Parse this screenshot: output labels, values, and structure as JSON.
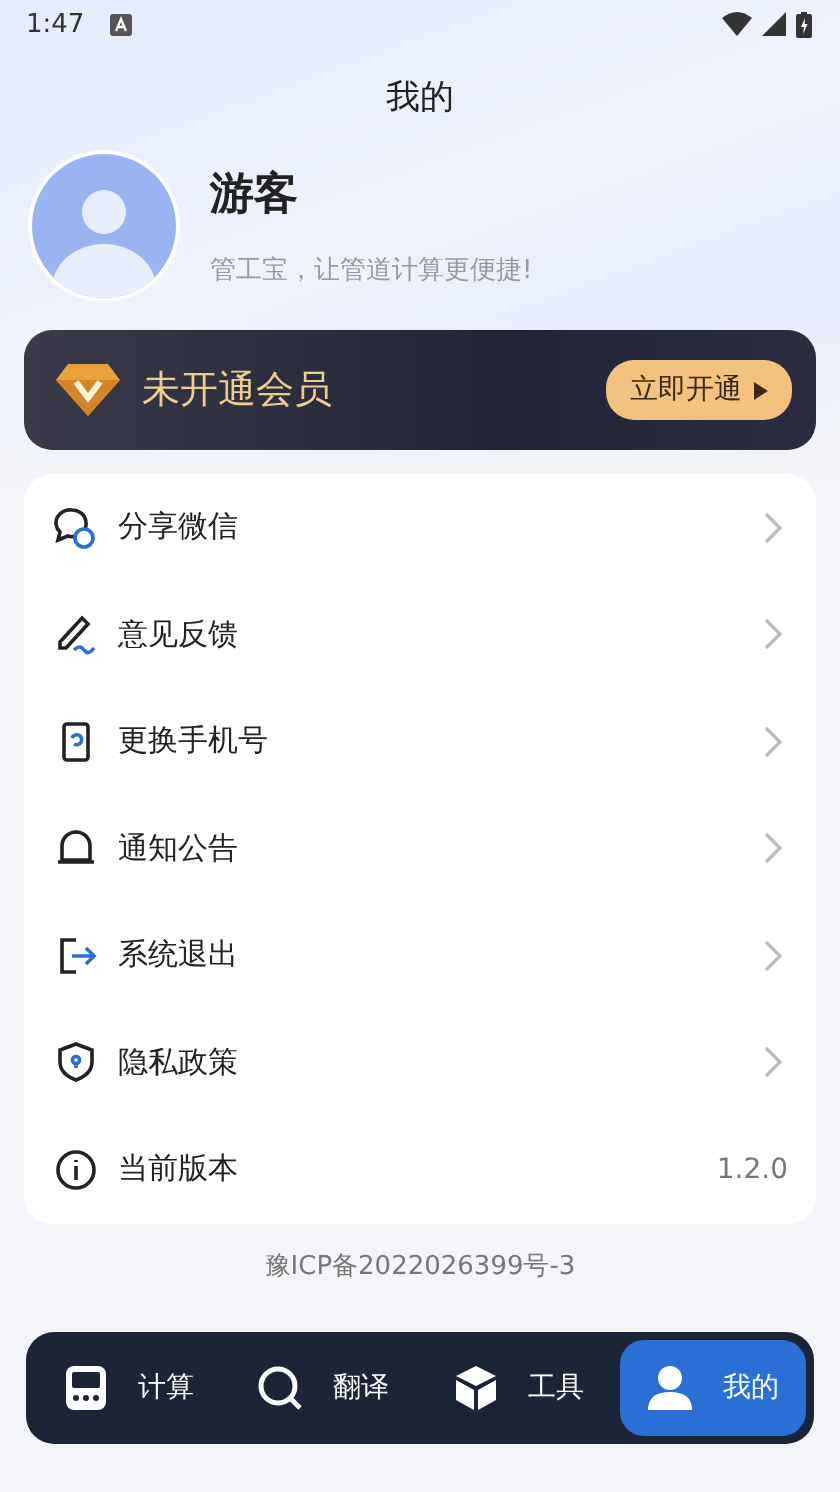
{
  "status_bar": {
    "time": "1:47"
  },
  "header": {
    "title": "我的"
  },
  "profile": {
    "name": "游客",
    "tagline": "管工宝，让管道计算更便捷!"
  },
  "membership": {
    "label": "未开通会员",
    "button": "立即开通"
  },
  "menu": [
    {
      "label": "分享微信",
      "kind": "link"
    },
    {
      "label": "意见反馈",
      "kind": "link"
    },
    {
      "label": "更换手机号",
      "kind": "link"
    },
    {
      "label": "通知公告",
      "kind": "link"
    },
    {
      "label": "系统退出",
      "kind": "link"
    },
    {
      "label": "隐私政策",
      "kind": "link"
    },
    {
      "label": "当前版本",
      "kind": "value",
      "value": "1.2.0"
    }
  ],
  "footer": {
    "icp": "豫ICP备2022026399号-3"
  },
  "tabs": [
    {
      "label": "计算",
      "selected": false
    },
    {
      "label": "翻译",
      "selected": false
    },
    {
      "label": "工具",
      "selected": false
    },
    {
      "label": "我的",
      "selected": true
    }
  ]
}
